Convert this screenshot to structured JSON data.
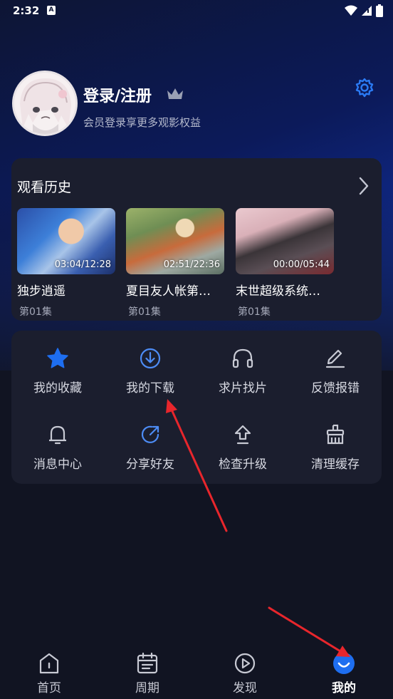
{
  "status_bar": {
    "time": "2:32",
    "notif_glyph": "A"
  },
  "profile": {
    "name": "登录/注册",
    "subtitle": "会员登录享更多观影权益",
    "icons": [
      "avatar",
      "crown-icon",
      "gear-icon"
    ]
  },
  "history": {
    "title": "观看历史",
    "items": [
      {
        "time": "03:04/12:28",
        "title": "独步逍遥",
        "episode": "第01集"
      },
      {
        "time": "02:51/22:36",
        "title": "夏目友人帐第…",
        "episode": "第01集"
      },
      {
        "time": "00:00/05:44",
        "title": "末世超级系统…",
        "episode": "第01集"
      }
    ]
  },
  "grid": {
    "items": [
      {
        "label": "我的收藏",
        "icon": "star-icon"
      },
      {
        "label": "我的下载",
        "icon": "download-icon"
      },
      {
        "label": "求片找片",
        "icon": "headphones-icon"
      },
      {
        "label": "反馈报错",
        "icon": "edit-icon"
      },
      {
        "label": "消息中心",
        "icon": "bell-icon"
      },
      {
        "label": "分享好友",
        "icon": "share-icon"
      },
      {
        "label": "检查升级",
        "icon": "upgrade-icon"
      },
      {
        "label": "清理缓存",
        "icon": "broom-icon"
      }
    ]
  },
  "nav": {
    "items": [
      {
        "label": "首页",
        "icon": "home-icon"
      },
      {
        "label": "周期",
        "icon": "calendar-icon"
      },
      {
        "label": "发现",
        "icon": "play-icon"
      },
      {
        "label": "我的",
        "icon": "smile-icon",
        "active": true
      }
    ]
  },
  "colors": {
    "accent": "#1e6ef0",
    "arrow": "#e8262c",
    "card": "#1b1e2e",
    "background": "#111422"
  }
}
